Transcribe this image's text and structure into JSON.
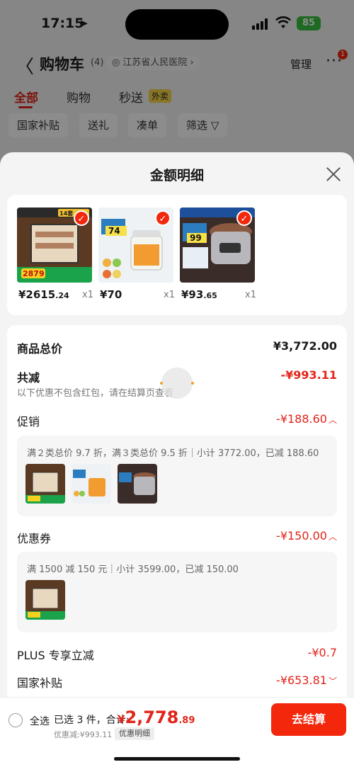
{
  "status_bar": {
    "time": "17:15",
    "battery": "85"
  },
  "nav": {
    "title": "购物车",
    "count": "(4)",
    "address": "江苏省人民医院",
    "manage": "管理",
    "badge": "1"
  },
  "tabs": [
    {
      "label": "全部"
    },
    {
      "label": "购物"
    },
    {
      "label": "秒送"
    }
  ],
  "tab_tag": "外卖",
  "filters": [
    {
      "label": "国家补贴"
    },
    {
      "label": "送礼"
    },
    {
      "label": "凑单"
    },
    {
      "label": "筛选"
    }
  ],
  "sheet": {
    "title": "金额明细",
    "products": [
      {
        "price_int": "¥2615",
        "price_dec": ".24",
        "qty": "x1",
        "img_text": "14套",
        "img_badge": "2879"
      },
      {
        "price_int": "¥70",
        "price_dec": "",
        "qty": "x1",
        "img_text": "74",
        "img_badge": ""
      },
      {
        "price_int": "¥93",
        "price_dec": ".65",
        "qty": "x1",
        "img_text": "99",
        "img_badge": ""
      }
    ],
    "total_label": "商品总价",
    "total_value": "¥3,772.00",
    "reduce_label": "共减",
    "reduce_value": "-¥993.11",
    "reduce_note": "以下优惠不包含红包，请在结算页查看",
    "promo_label": "促销",
    "promo_value": "-¥188.60",
    "promo_detail": "满２类总价 9.7 折，满３类总价 9.5 折｜小计 3772.00，已减 188.60",
    "coupon_label": "优惠券",
    "coupon_value": "-¥150.00",
    "coupon_detail": "满 1500 减 150 元｜小计 3599.00，已减 150.00",
    "plus_label": "PLUS 专享立减",
    "plus_value": "-¥0.7",
    "subsidy_label": "国家补贴",
    "subsidy_value": "-¥653.81"
  },
  "bottom": {
    "select_all": "全选",
    "selected": "已选 3 件，合计:",
    "currency": "¥",
    "total_int": "2,778",
    "total_dec": ".89",
    "discount": "优惠减:¥993.11",
    "detail_chip": "优惠明细",
    "checkout": "去结算"
  },
  "colors": {
    "accent": "#e1251b",
    "checkout": "#f2270c"
  }
}
